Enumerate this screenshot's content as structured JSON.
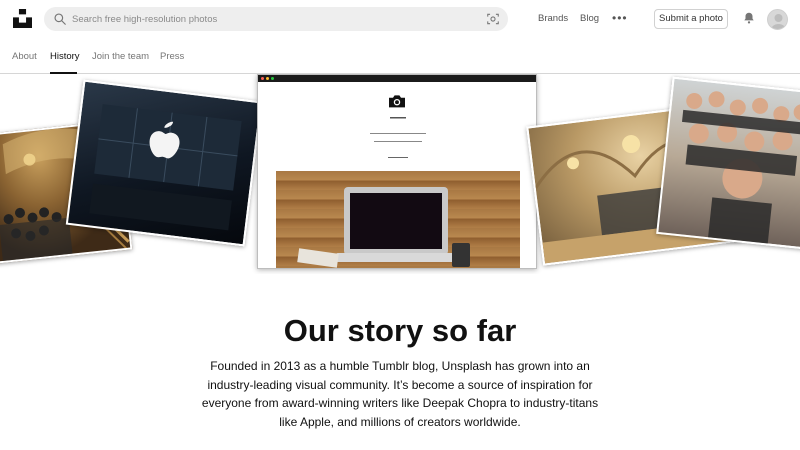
{
  "header": {
    "search_placeholder": "Search free high-resolution photos",
    "links": [
      "Brands",
      "Blog"
    ],
    "more_label": "•••",
    "submit_label": "Submit a photo"
  },
  "tabs": [
    {
      "label": "About",
      "active": false
    },
    {
      "label": "History",
      "active": true
    },
    {
      "label": "Join the team",
      "active": false
    },
    {
      "label": "Press",
      "active": false
    }
  ],
  "collage": {
    "photos": [
      "staircase-group-photo",
      "apple-store-photo",
      "browser-screenshot",
      "building-lobby-photo",
      "team-selfie-photo"
    ],
    "browser_icon": "camera-icon"
  },
  "story": {
    "title": "Our story so far",
    "text": "Founded in 2013 as a humble Tumblr blog, Unsplash has grown into an industry-leading visual community. It’s become a source of inspiration for everyone from award-winning writers like Deepak Chopra to industry-titans like Apple, and millions of creators worldwide."
  },
  "colors": {
    "text": "#111111",
    "muted": "#767676",
    "search_bg": "#eeeeee",
    "border": "#d1d1d1"
  }
}
